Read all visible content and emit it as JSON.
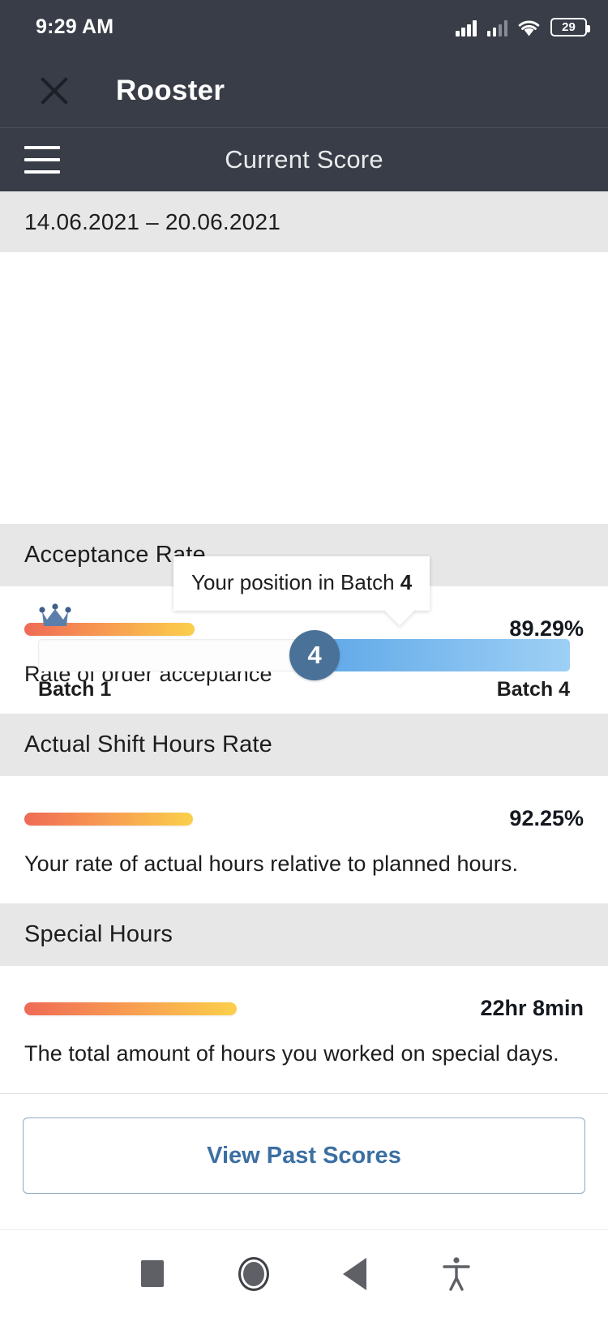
{
  "status_bar": {
    "time": "9:29 AM",
    "battery_percent": "29",
    "icons": [
      "signal-icon",
      "signal-icon",
      "wifi-icon",
      "battery-icon"
    ]
  },
  "app_bar": {
    "close_icon": "close-icon",
    "title": "Rooster"
  },
  "sub_bar": {
    "menu_icon": "hamburger-menu-icon",
    "title": "Current Score"
  },
  "date_range": {
    "text": "14.06.2021 – 20.06.2021"
  },
  "batch_position": {
    "tooltip_prefix": "Your position in Batch",
    "tooltip_value": "4",
    "crown_icon": "crown-icon",
    "knob_value": "4",
    "fill_percent": 48,
    "start_label": "Batch 1",
    "end_label": "Batch 4",
    "fill_color_start": "#5fa8e8",
    "fill_color_end": "#9ed0f5",
    "knob_color": "#4a7197"
  },
  "metrics": [
    {
      "title": "Acceptance Rate",
      "value": "89.29%",
      "description": "Rate of order acceptance",
      "bar_width_percent": 30.4
    },
    {
      "title": "Actual Shift Hours Rate",
      "value": "92.25%",
      "description": "Your rate of actual hours relative to planned hours.",
      "bar_width_percent": 30.1
    },
    {
      "title": "Special Hours",
      "value": "22hr 8min",
      "description": "The total amount of hours you worked on special days.",
      "bar_width_percent": 38.0
    }
  ],
  "footer": {
    "past_scores_label": "View Past Scores",
    "accent_color": "#3c6fa3"
  },
  "nav_bar": {
    "items": [
      "recents-square-icon",
      "home-circle-icon",
      "back-triangle-icon",
      "accessibility-icon"
    ]
  }
}
